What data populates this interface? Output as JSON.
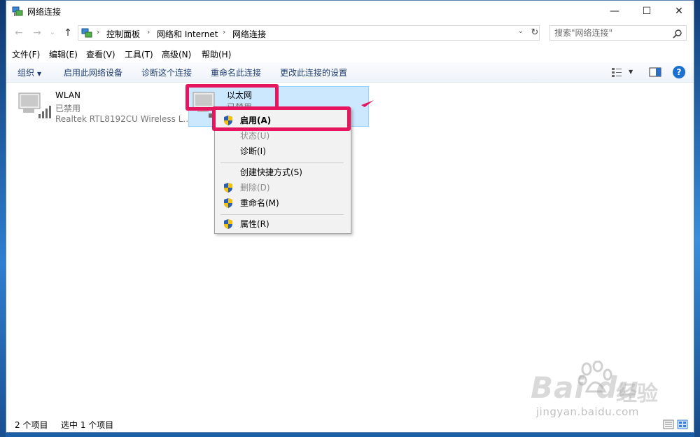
{
  "window": {
    "title": "网络连接",
    "controls": {
      "minimize": "—",
      "maximize": "☐",
      "close": "✕"
    }
  },
  "address": {
    "back": "←",
    "forward": "→",
    "recent": "⌄",
    "up": "↑",
    "crumbs": [
      "控制面板",
      "网络和 Internet",
      "网络连接"
    ],
    "separator": "›",
    "dropdown": "⌄",
    "refresh": "↻",
    "search_placeholder": "搜索\"网络连接\""
  },
  "menu": {
    "items": [
      "文件(F)",
      "编辑(E)",
      "查看(V)",
      "工具(T)",
      "高级(N)",
      "帮助(H)"
    ]
  },
  "commands": {
    "organize": "组织",
    "organize_caret": "▼",
    "enable_device": "启用此网络设备",
    "diagnose": "诊断这个连接",
    "rename": "重命名此连接",
    "change_settings": "更改此连接的设置",
    "view_caret": "▼",
    "help": "?"
  },
  "connections": [
    {
      "name": "WLAN",
      "status": "已禁用",
      "device": "Realtek RTL8192CU Wireless L..."
    },
    {
      "name": "以太网",
      "status": "已禁用",
      "device": ""
    }
  ],
  "context_menu": {
    "items": [
      {
        "label": "启用(A)",
        "shield": true,
        "disabled": false,
        "bold": true
      },
      {
        "label": "状态(U)",
        "shield": false,
        "disabled": true,
        "bold": false
      },
      {
        "label": "诊断(I)",
        "shield": false,
        "disabled": false,
        "bold": false
      },
      {
        "label": "创建快捷方式(S)",
        "shield": false,
        "disabled": false,
        "bold": false
      },
      {
        "label": "删除(D)",
        "shield": true,
        "disabled": true,
        "bold": false
      },
      {
        "label": "重命名(M)",
        "shield": true,
        "disabled": false,
        "bold": false
      },
      {
        "label": "属性(R)",
        "shield": true,
        "disabled": false,
        "bold": false
      }
    ]
  },
  "status": {
    "item_count": "2 个项目",
    "selected_count": "选中 1 个项目"
  },
  "watermark": {
    "brand": "Bai du",
    "jingyan": "经验",
    "url": "jingyan.baidu.com"
  },
  "colors": {
    "highlight": "#e5155e",
    "selection": "#cce8ff",
    "command_text": "#1e3c6e"
  }
}
